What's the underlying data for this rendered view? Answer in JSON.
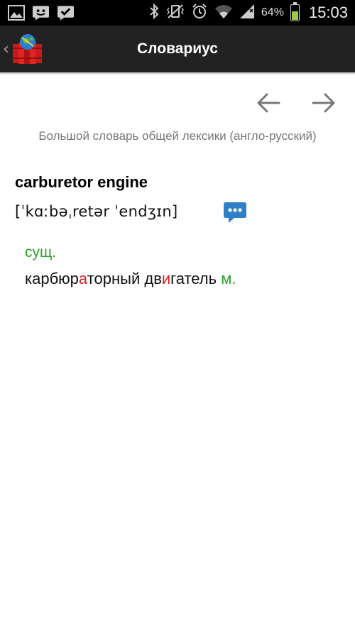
{
  "status_bar": {
    "battery_percent": "64%",
    "battery_level": 0.64,
    "time": "15:03",
    "icons_left": [
      "gallery-icon",
      "messenger-icon",
      "check-icon"
    ],
    "icons_right": [
      "bluetooth-icon",
      "vibrate-icon",
      "alarm-icon",
      "wifi-icon",
      "signal-icon",
      "battery-icon"
    ]
  },
  "action_bar": {
    "title": "Словариус",
    "up_icon": "‹"
  },
  "navigation": {
    "back_icon": "arrow-left-icon",
    "forward_icon": "arrow-right-icon"
  },
  "article": {
    "dictionary_name": "Большой словарь общей лексики (англо-русский)",
    "headword": "carburetor engine",
    "transcription": "[ˈkɑːbəˌretər ˈendʒɪn]",
    "part_of_speech": "сущ.",
    "translation": {
      "seg1": "карбюр",
      "stress1": "а",
      "seg2": "торный дв",
      "stress2": "и",
      "seg3": "гатель",
      "gender": "м."
    }
  },
  "colors": {
    "action_bar": "#222222",
    "green": "#2aa12a",
    "stress_red": "#d62222",
    "speak_blue": "#2f80c8"
  }
}
